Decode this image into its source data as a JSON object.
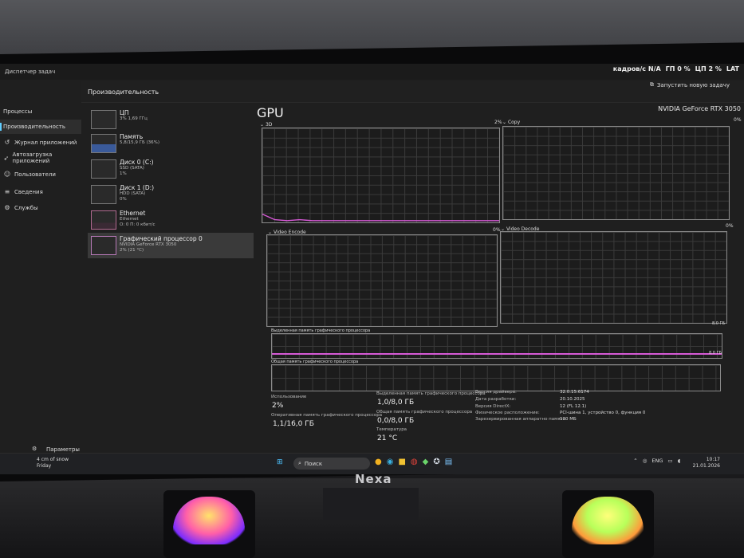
{
  "window": {
    "title": "Диспетчер задач",
    "page_title": "Производительность",
    "run_task": "Запустить новую задачу"
  },
  "overlay": {
    "kadrov": "кадров/с N/A",
    "gp": "ГП 0 %",
    "cp": "ЦП 2 %",
    "lat": "LAT"
  },
  "nav": {
    "items": [
      {
        "label": "Процессы",
        "icon": "grid-icon"
      },
      {
        "label": "Производительность",
        "icon": "pulse-icon"
      },
      {
        "label": "Журнал приложений",
        "icon": "history-icon"
      },
      {
        "label": "Автозагрузка приложений",
        "icon": "rocket-icon"
      },
      {
        "label": "Пользователи",
        "icon": "users-icon"
      },
      {
        "label": "Сведения",
        "icon": "list-icon"
      },
      {
        "label": "Службы",
        "icon": "gear-icon"
      }
    ],
    "settings": "Параметры"
  },
  "devices": [
    {
      "name": "ЦП",
      "sub": "3% 1,69 ГГц"
    },
    {
      "name": "Память",
      "sub": "5,8/15,9 ГБ (36%)"
    },
    {
      "name": "Диск 0 (C:)",
      "sub": "SSD (SATA)\n1%"
    },
    {
      "name": "Диск 1 (D:)",
      "sub": "HDD (SATA)\n0%"
    },
    {
      "name": "Ethernet",
      "sub": "Ethernet\nО: 0 П: 0 кбит/с"
    },
    {
      "name": "Графический процессор 0",
      "sub": "NVIDIA GeForce RTX 3050\n2% (21 °C)"
    }
  ],
  "gpu": {
    "title": "GPU",
    "model": "NVIDIA GeForce RTX 3050",
    "engines": [
      {
        "name": "3D",
        "value": "2%"
      },
      {
        "name": "Copy",
        "value": "0%"
      },
      {
        "name": "Video Encode",
        "value": "0%"
      },
      {
        "name": "Video Decode",
        "value": "0%"
      }
    ],
    "dedicated_label": "Выделенная память графического процессора",
    "dedicated_max": "8,0 ГБ",
    "dedicated_now": "8,0 ГБ",
    "shared_label": "Общая память графического процессора",
    "stats": {
      "usage_label": "Использование",
      "usage": "2%",
      "dedicated_label": "Выделенная память графического процессора",
      "dedicated": "1,0/8,0 ГБ",
      "shared_label": "Общая память графического процессора",
      "shared": "0,0/8,0 ГБ",
      "ram_label": "Оперативная память графического процессора",
      "ram": "1,1/16,0 ГБ",
      "temp_label": "Температура",
      "temp": "21 °C"
    },
    "info": [
      {
        "k": "Версия драйвера:",
        "v": "32.0.15.6174"
      },
      {
        "k": "Дата разработки:",
        "v": "20.10.2025"
      },
      {
        "k": "Версия DirectX:",
        "v": "12 (FL 12.1)"
      },
      {
        "k": "Физическое расположение:",
        "v": "PCI-шина 1, устройство 0, функция 0"
      },
      {
        "k": "Зарезервированная аппаратно память:",
        "v": "130 МБ"
      }
    ]
  },
  "taskbar": {
    "weather": "4 cm of snow",
    "weather_day": "Friday",
    "search": "Поиск",
    "lang": "ENG",
    "time": "10:17",
    "date": "21.01.2026"
  },
  "monitor_brand": "Nexa",
  "chart_data": {
    "type": "line",
    "title": "3D",
    "series": [
      {
        "name": "3D",
        "values": [
          8,
          2,
          1,
          2,
          1,
          1,
          1,
          1,
          1,
          1,
          1,
          1,
          1,
          1,
          1,
          1,
          1,
          1,
          1,
          1
        ]
      }
    ],
    "ylim": [
      0,
      100
    ]
  }
}
